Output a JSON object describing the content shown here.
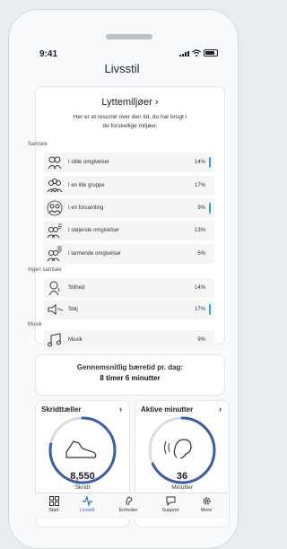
{
  "status_bar": {
    "time": "9:41"
  },
  "page": {
    "title": "Livsstil"
  },
  "environments": {
    "title": "Lyttemiljøer ›",
    "subtitle": "Her er et resumé over den tid, du har brugt i de forskellige miljøer.",
    "groups": [
      {
        "label": "Samtale",
        "items": [
          {
            "label": "I stille omgivelser",
            "pct": "14%",
            "icon": "quiet-conversation-icon"
          },
          {
            "label": "I en lille gruppe",
            "pct": "17%",
            "icon": "small-group-icon"
          },
          {
            "label": "I en forsamling",
            "pct": "9%",
            "icon": "crowd-icon"
          },
          {
            "label": "I  støjende omgivelser",
            "pct": "13%",
            "icon": "noisy-conversation-icon"
          },
          {
            "label": "I larmende omgivelser",
            "pct": "5%",
            "icon": "loud-conversation-icon"
          }
        ]
      },
      {
        "label": "Ingen samtale",
        "items": [
          {
            "label": "Stilhed",
            "pct": "14%",
            "icon": "silence-icon"
          },
          {
            "label": "Støj",
            "pct": "17%",
            "icon": "noise-icon"
          }
        ]
      },
      {
        "label": "Musik",
        "items": [
          {
            "label": "Musik",
            "pct": "9%",
            "icon": "music-icon"
          }
        ]
      }
    ]
  },
  "average_wear": {
    "title": "Gennemsnitlig bæretid pr. dag:",
    "value": "8 timer 6 minutter"
  },
  "step_counter": {
    "title": "Skridttæller",
    "chevron": "›",
    "value": "8,550",
    "unit": "Skridt",
    "icon": "shoe-icon",
    "progress": 0.78
  },
  "active_minutes": {
    "title": "Aktive minutter",
    "chevron": "›",
    "value": "36",
    "unit": "Minutter",
    "icon": "ear-icon",
    "progress": 0.68
  },
  "nav": [
    {
      "label": "Start",
      "icon": "grid-icon"
    },
    {
      "label": "Livsstil",
      "icon": "activity-icon",
      "active": true
    },
    {
      "label": "Enheder",
      "icon": "hearing-aid-icon"
    },
    {
      "label": "Support",
      "icon": "chat-icon"
    },
    {
      "label": "Mere",
      "icon": "gear-icon"
    }
  ],
  "colors": {
    "accent": "#2a6fbd",
    "ring": "#3b5ea7",
    "mark": "#3a9bd9"
  }
}
